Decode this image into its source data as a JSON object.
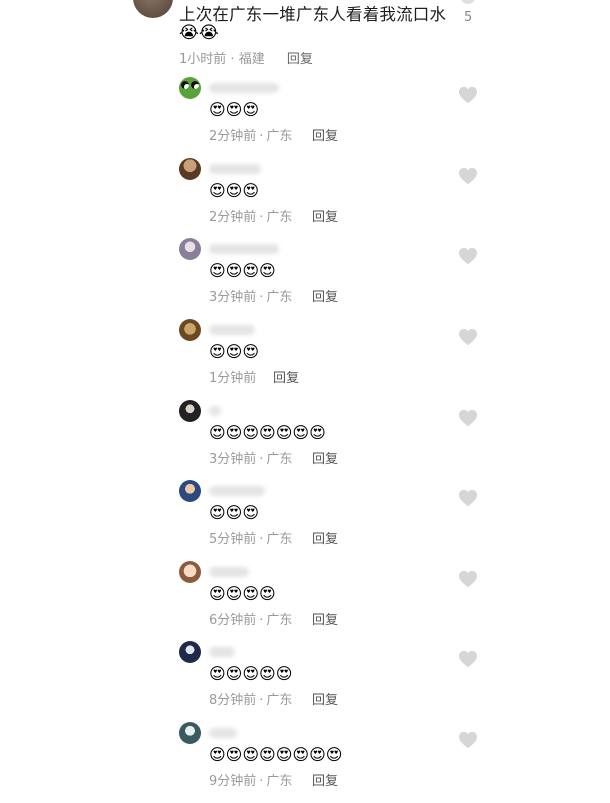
{
  "top_comment": {
    "text": "上次在广东一堆广东人看着我流口水",
    "emojis": "😭😭",
    "time": "1小时前",
    "location": "福建",
    "reply_label": "回复",
    "like_count": "5"
  },
  "replies": [
    {
      "avatar": "frog-avatar",
      "emojis": "😍😍😍",
      "time": "2分钟前",
      "location": "广东",
      "reply_label": "回复"
    },
    {
      "avatar": "avatar",
      "emojis": "😍😍😍",
      "time": "2分钟前",
      "location": "广东",
      "reply_label": "回复"
    },
    {
      "avatar": "avatar",
      "emojis": "😍😍😍😍",
      "time": "3分钟前",
      "location": "广东",
      "reply_label": "回复"
    },
    {
      "avatar": "avatar",
      "emojis": "😍😍😍",
      "time": "1分钟前",
      "location": "",
      "reply_label": "回复"
    },
    {
      "avatar": "avatar",
      "emojis": "😍😍😍😍😍😍😍",
      "time": "3分钟前",
      "location": "广东",
      "reply_label": "回复"
    },
    {
      "avatar": "avatar",
      "emojis": "😍😍😍",
      "time": "5分钟前",
      "location": "广东",
      "reply_label": "回复"
    },
    {
      "avatar": "avatar",
      "emojis": "😍😍😍😍",
      "time": "6分钟前",
      "location": "广东",
      "reply_label": "回复"
    },
    {
      "avatar": "avatar",
      "emojis": "😍😍😍😍😍",
      "time": "8分钟前",
      "location": "广东",
      "reply_label": "回复"
    },
    {
      "avatar": "avatar",
      "emojis": "😍😍😍😍😍😍😍😍",
      "time": "9分钟前",
      "location": "广东",
      "reply_label": "回复"
    }
  ],
  "colors": {
    "heart": "#d6d6d6",
    "meta_text": "#9a9a9a"
  }
}
